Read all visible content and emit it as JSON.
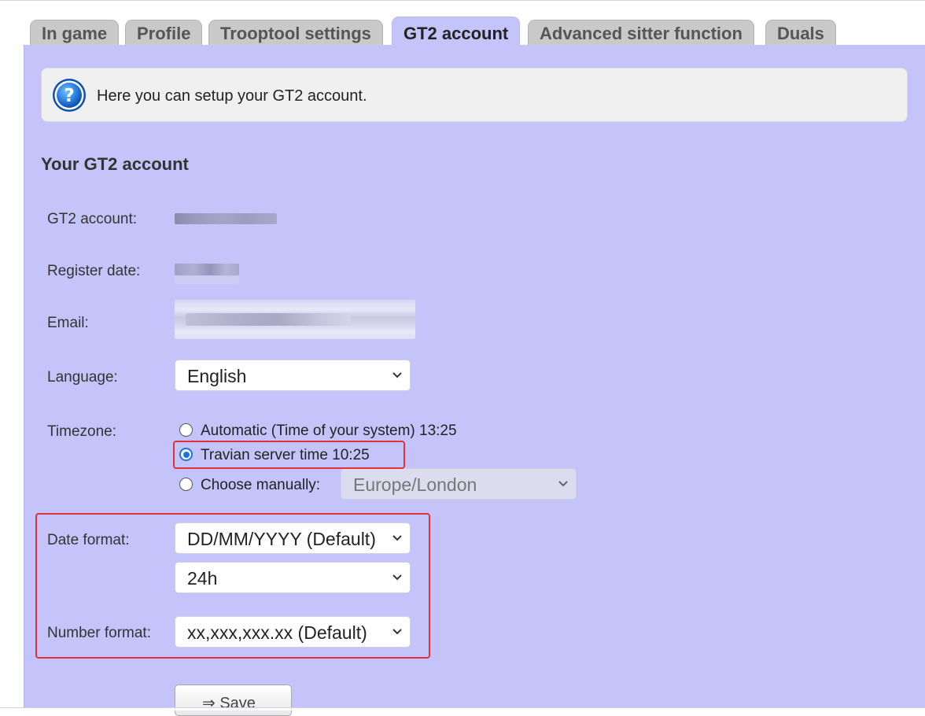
{
  "tabs": [
    {
      "label": "In game"
    },
    {
      "label": "Profile"
    },
    {
      "label": "Trooptool settings"
    },
    {
      "label": "GT2 account"
    },
    {
      "label": "Advanced sitter function"
    },
    {
      "label": "Duals"
    }
  ],
  "active_tab": "GT2 account",
  "info": {
    "icon": "help-icon",
    "text": "Here you can setup your GT2 account."
  },
  "section": {
    "title": "Your GT2 account"
  },
  "fields": {
    "gt2_account_label": "GT2 account:",
    "register_date_label": "Register date:",
    "email_label": "Email:",
    "language_label": "Language:",
    "language_value": "English",
    "timezone_label": "Timezone:",
    "timezone_options": [
      {
        "label": "Automatic (Time of your system) 13:25",
        "checked": false
      },
      {
        "label": "Travian server time 10:25",
        "checked": true
      },
      {
        "label": "Choose manually:",
        "checked": false
      }
    ],
    "timezone_manual_value": "Europe/London",
    "date_format_label": "Date format:",
    "date_format_value": "DD/MM/YYYY (Default)",
    "time_format_value": "24h",
    "number_format_label": "Number format:",
    "number_format_value": "xx,xxx,xxx.xx (Default)"
  },
  "save": {
    "label": "⇒ Save"
  },
  "colors": {
    "panel_bg": "#c4c4fa",
    "highlight": "#e0323c",
    "radio_checked": "#1a73e8"
  }
}
